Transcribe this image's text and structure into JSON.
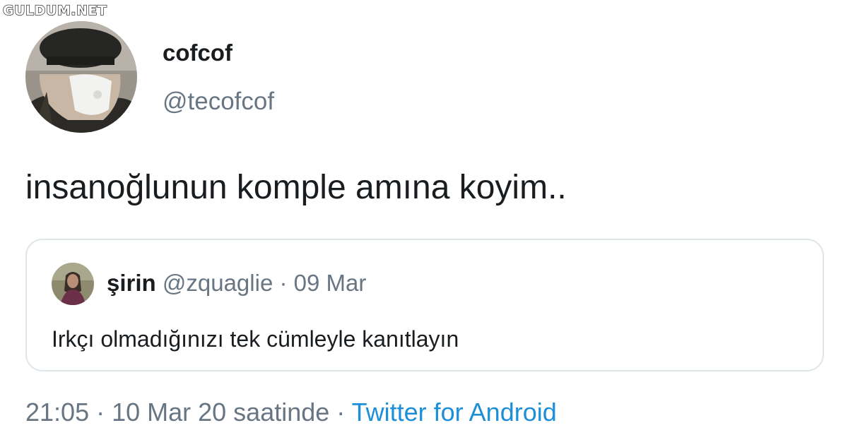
{
  "watermark": "GULDUM.NET",
  "tweet": {
    "display_name": "cofcof",
    "handle": "@tecofcof",
    "text": "insanoğlunun komple amına koyim..",
    "timestamp": "21:05 · 10 Mar 20 saatinde",
    "separator": " · ",
    "source": "Twitter for Android"
  },
  "quoted_tweet": {
    "display_name": "şirin",
    "handle": "@zquaglie",
    "separator": " · ",
    "date": "09 Mar",
    "text": "Irkçı olmadığınızı tek cümleyle kanıtlayın"
  },
  "colors": {
    "text_primary": "#14171a",
    "text_secondary": "#687684",
    "link": "#1d8fd8",
    "border": "#dfe6ea"
  }
}
